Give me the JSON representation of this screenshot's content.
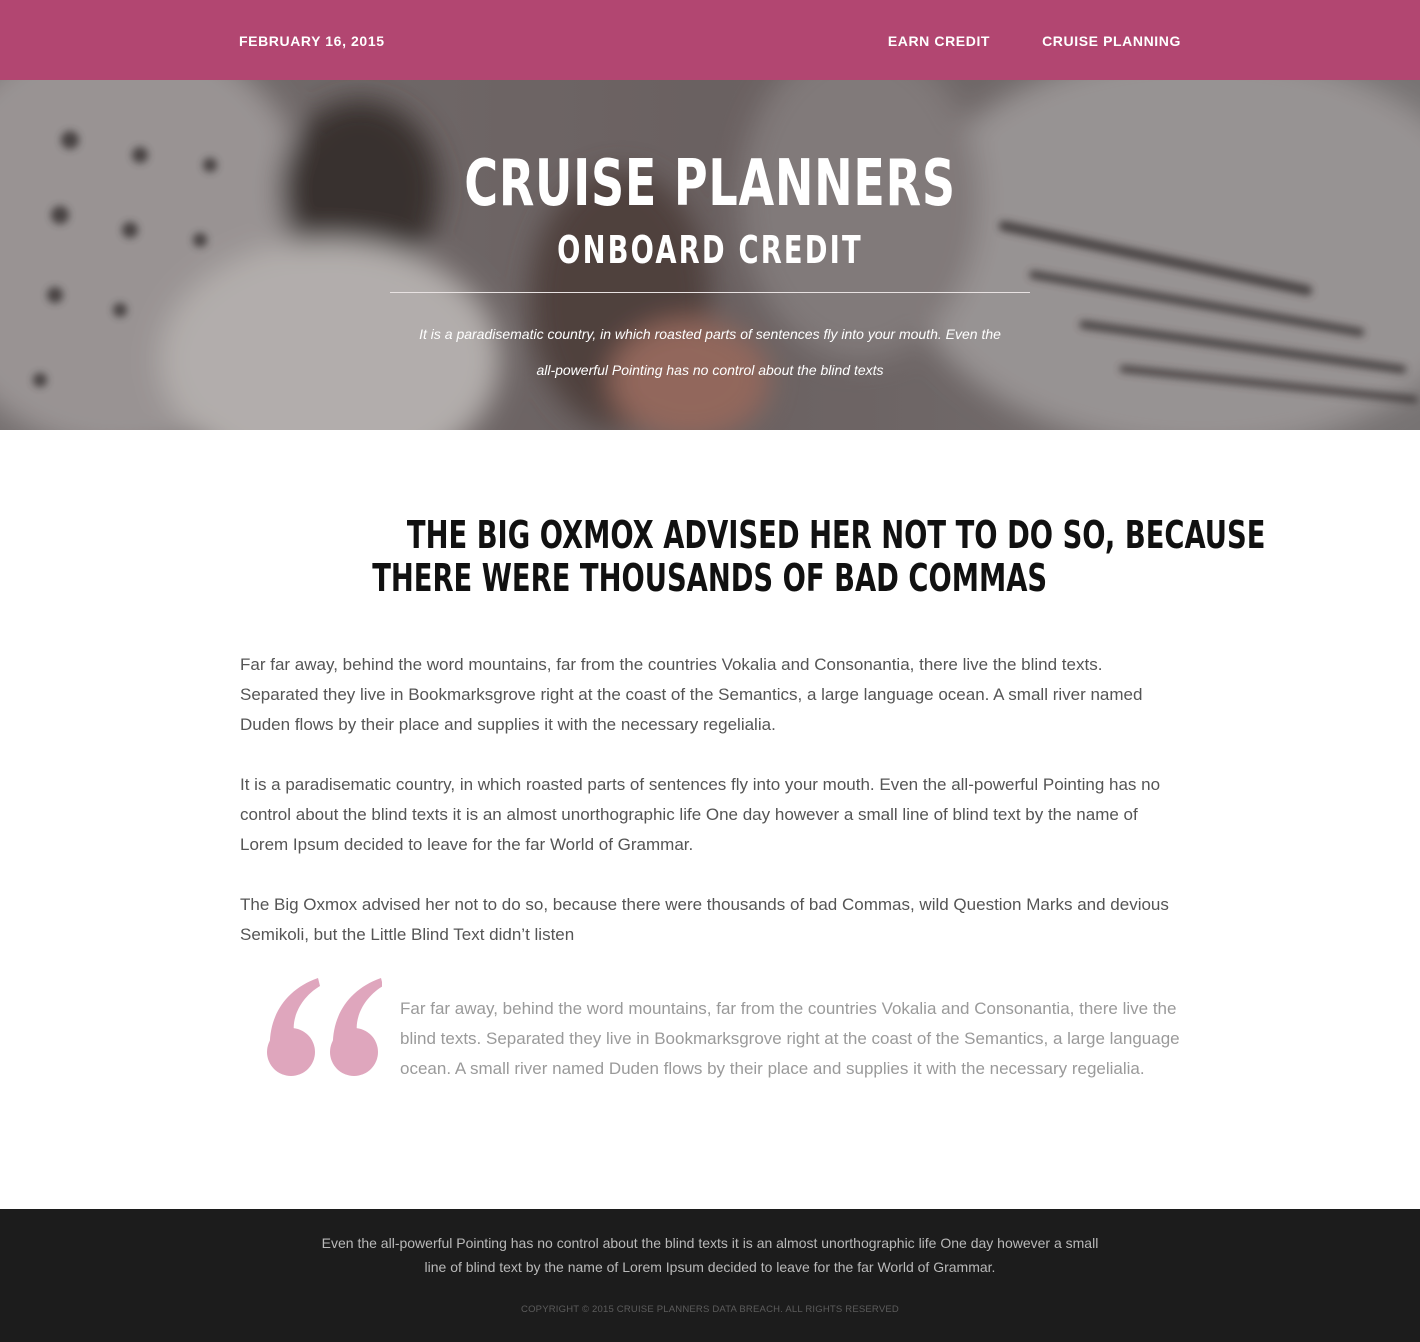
{
  "header": {
    "date": "FEBRUARY 16, 2015",
    "nav": [
      {
        "label": "EARN CREDIT"
      },
      {
        "label": "CRUISE PLANNING"
      }
    ],
    "bg_color": "#b24671"
  },
  "hero": {
    "title": "CRUISE PLANNERS",
    "subtitle": "ONBOARD CREDIT",
    "tagline": "It is a paradisematic country, in which roasted parts of sentences fly into your mouth. Even the all-powerful Pointing has no control about the blind texts"
  },
  "article": {
    "heading_line1": "THE BIG OXMOX ADVISED HER NOT TO DO SO, BECAUSE",
    "heading_line2": "THERE WERE THOUSANDS OF BAD COMMAS",
    "paragraphs": [
      "Far far away, behind the word mountains, far from the countries Vokalia and Consonantia, there live the blind texts. Separated they live in Bookmarksgrove right at the coast of the Semantics, a large language ocean. A small river named Duden flows by their place and supplies it with the necessary regelialia.",
      "It is a paradisematic country, in which roasted parts of sentences fly into your mouth. Even the all-powerful Pointing has no control about the blind texts it is an almost unorthographic life One day however a small line of blind text by the name of Lorem Ipsum decided to leave for the far World of Grammar.",
      "The Big Oxmox advised her not to do so, because there were thousands of bad Commas, wild Question Marks and devious Semikoli, but the Little Blind Text didn’t listen"
    ],
    "quote": "Far far away, behind the word mountains, far from the countries Vokalia and Consonantia, there live the blind texts. Separated they live in Bookmarksgrove right at the coast of the Semantics, a large language ocean. A small river named Duden flows by their place and supplies it with the necessary regelialia.",
    "quote_icon": "quote-open-icon",
    "quote_color": "#dfa6bd"
  },
  "footer": {
    "text": "Even the all-powerful Pointing has no control about the blind texts it is an almost unorthographic life One day however a small line of blind text by the name of Lorem Ipsum decided to leave for the far World of Grammar.",
    "copyright": "COPYRIGHT © 2015 CRUISE PLANNERS DATA BREACH. ALL RIGHTS RESERVED",
    "bg_color": "#1c1c1c"
  }
}
